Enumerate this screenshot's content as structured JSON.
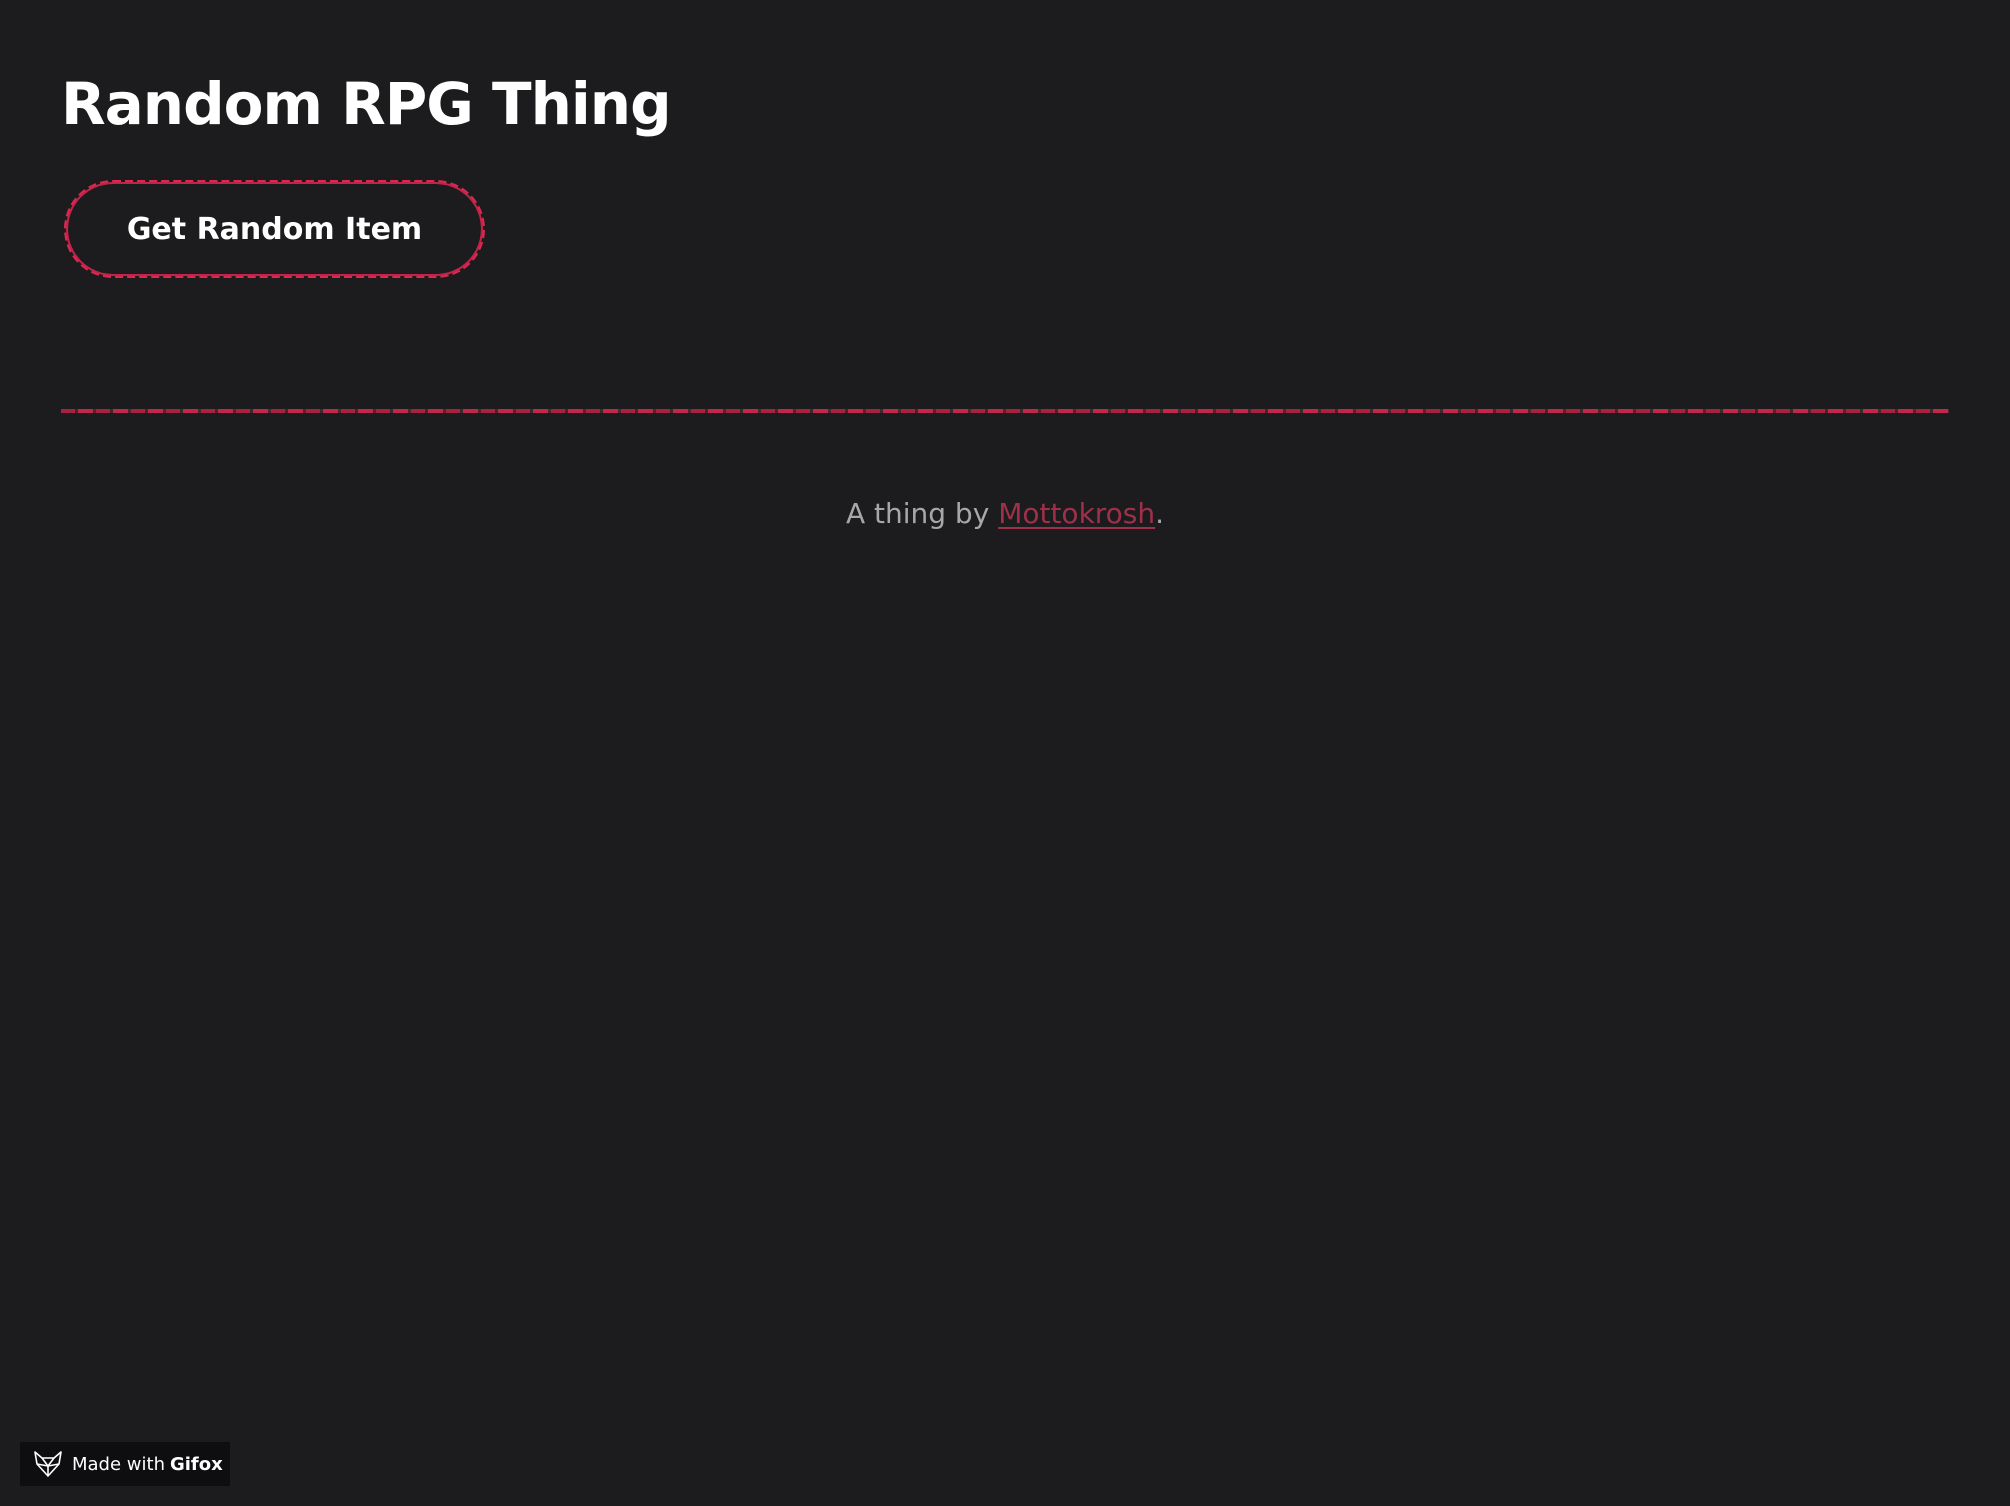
{
  "page": {
    "title": "Random RPG Thing"
  },
  "actions": {
    "random_item_label": "Get Random Item"
  },
  "footer": {
    "credit_prefix": "A thing by ",
    "author_link": "Mottokrosh",
    "credit_suffix": "."
  },
  "badge": {
    "made_with": "Made with",
    "brand": "Gifox",
    "icon": "fox-icon"
  },
  "colors": {
    "background": "#1c1c1e",
    "accent": "#d8294f",
    "link": "#9e3149",
    "muted_text": "#a7a7a9"
  }
}
